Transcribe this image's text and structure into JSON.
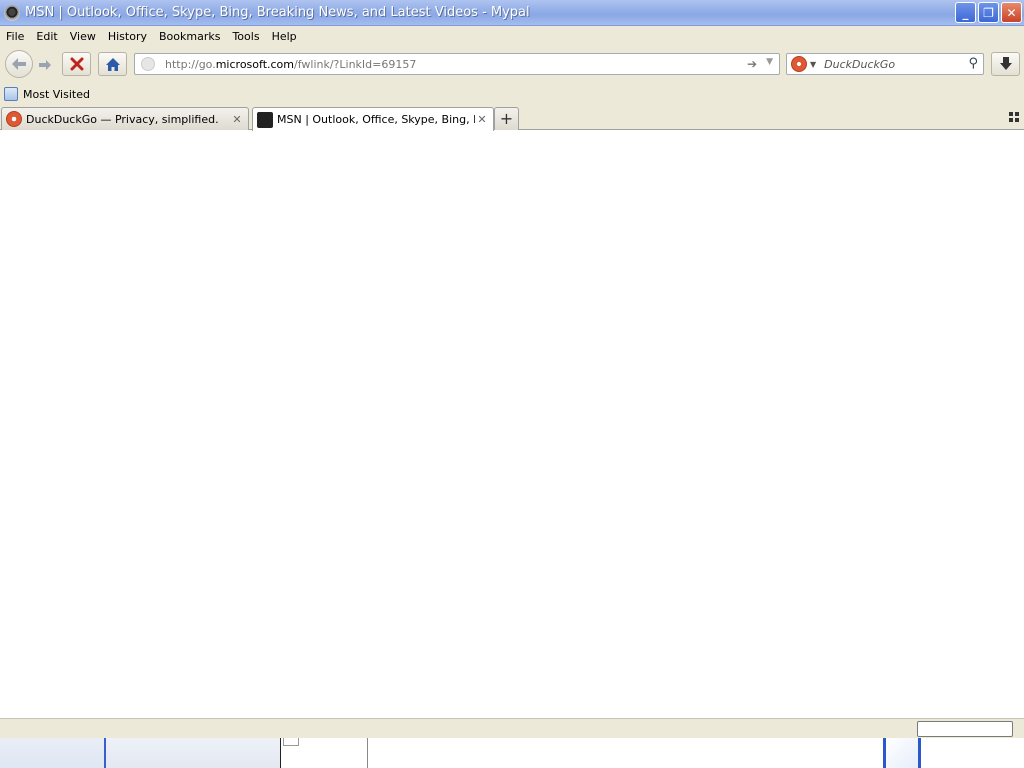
{
  "window": {
    "title": "MSN | Outlook, Office, Skype, Bing, Breaking News, and Latest Videos - Mypal",
    "app_icon": "mypal-icon"
  },
  "menu": [
    "File",
    "Edit",
    "View",
    "History",
    "Bookmarks",
    "Tools",
    "Help"
  ],
  "navbar": {
    "url_prefix": "http://go.",
    "url_host": "microsoft.com",
    "url_suffix": "/fwlink/?LinkId=69157",
    "search_placeholder": "DuckDuckGo"
  },
  "bookmarks": {
    "most_visited": "Most Visited"
  },
  "tabs": [
    {
      "label": "DuckDuckGo — Privacy, simplified.",
      "favicon": "duckduckgo-icon",
      "active": false
    },
    {
      "label": "MSN | Outlook, Office, Skype, Bing, Brea...",
      "favicon": "msn-icon",
      "active": true
    }
  ],
  "colors": {
    "titlebar": "#94b0e8",
    "chrome": "#ece9d8",
    "accent": "#2b58cc",
    "duckduckgo": "#de5833"
  }
}
